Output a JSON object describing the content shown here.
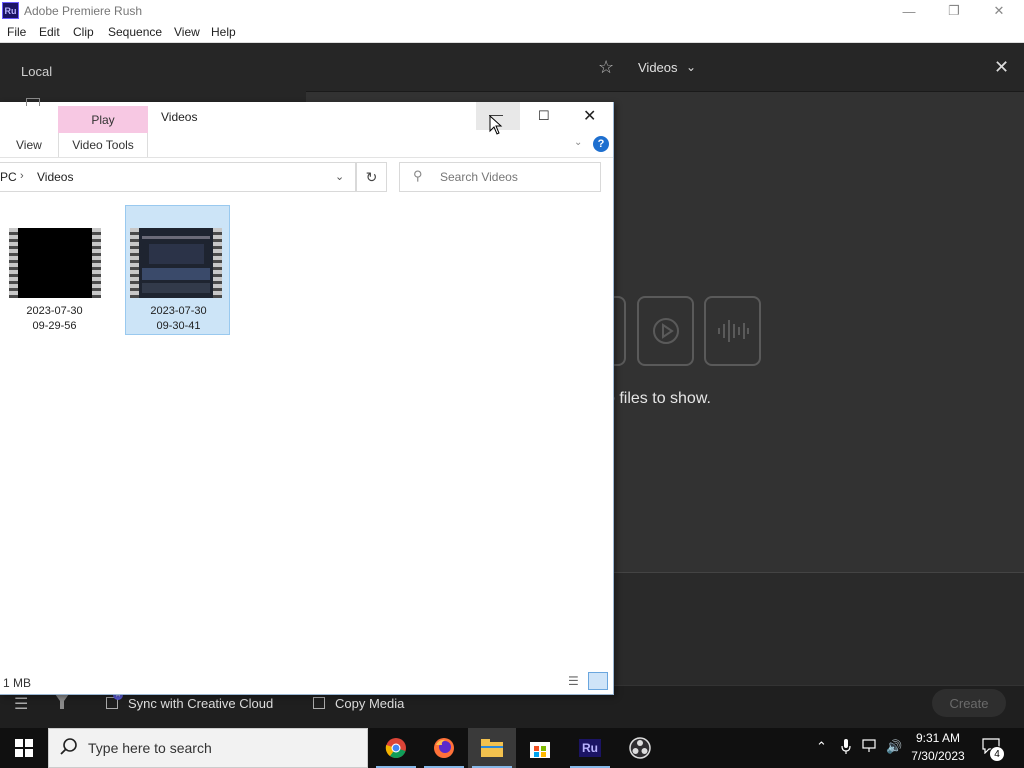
{
  "rush": {
    "logo": "Ru",
    "title": "Adobe Premiere Rush",
    "menu": [
      "File",
      "Edit",
      "Clip",
      "Sequence",
      "View",
      "Help"
    ],
    "local_label": "Local",
    "location_dropdown": "Videos",
    "empty_message": "o files to show.",
    "sync_label": "Sync with Creative Cloud",
    "copy_media_label": "Copy Media",
    "create_label": "Create"
  },
  "explorer": {
    "title": "Videos",
    "tab_play": "Play",
    "ribbon_view": "View",
    "ribbon_video_tools": "Video Tools",
    "address": {
      "root": "PC",
      "folder": "Videos"
    },
    "search_placeholder": "Search Videos",
    "files": [
      {
        "line1": "2023-07-30",
        "line2": "09-29-56",
        "selected": false
      },
      {
        "line1": "2023-07-30",
        "line2": "09-30-41",
        "selected": true
      }
    ],
    "status_size": "1 MB"
  },
  "taskbar": {
    "search_placeholder": "Type here to search",
    "rush_label": "Ru",
    "time": "9:31 AM",
    "date": "7/30/2023",
    "notifications": "4"
  },
  "colors": {
    "rush_dark": "#232323",
    "selection_blue": "#cce4f7",
    "play_tab_pink": "#f7c8e3",
    "taskbar": "#101010"
  }
}
